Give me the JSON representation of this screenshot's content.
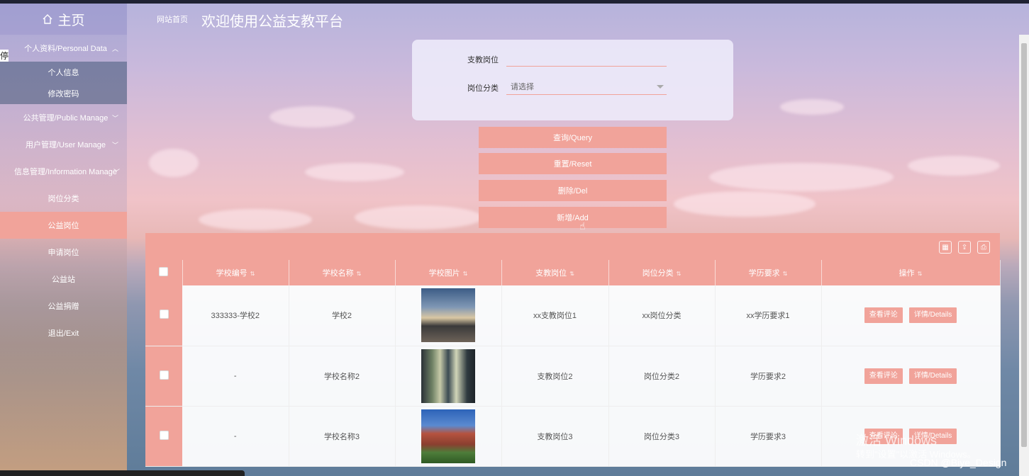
{
  "header": {
    "home_label": "主页",
    "breadcrumb": "网站首页",
    "title": "欢迎使用公益支教平台"
  },
  "sidebar": {
    "side_glyph": "停",
    "items": [
      {
        "label": "个人资料/Personal Data",
        "type": "group",
        "chevron": "︿"
      },
      {
        "label": "个人信息",
        "type": "sub"
      },
      {
        "label": "修改密码",
        "type": "sub"
      },
      {
        "label": "公共管理/Public Manage",
        "type": "group",
        "chevron": "﹀"
      },
      {
        "label": "用户管理/User Manage",
        "type": "group",
        "chevron": "﹀"
      },
      {
        "label": "信息管理/Information Manage",
        "type": "group",
        "chevron": "﹀"
      },
      {
        "label": "岗位分类",
        "type": "item"
      },
      {
        "label": "公益岗位",
        "type": "item",
        "active": true
      },
      {
        "label": "申请岗位",
        "type": "item"
      },
      {
        "label": "公益站",
        "type": "item"
      },
      {
        "label": "公益捐赠",
        "type": "item"
      },
      {
        "label": "退出/Exit",
        "type": "item"
      }
    ]
  },
  "search": {
    "position_label": "支教岗位",
    "position_value": "",
    "category_label": "岗位分类",
    "category_placeholder": "请选择"
  },
  "buttons": {
    "query": "查询/Query",
    "reset": "重置/Reset",
    "delete": "删除/Del",
    "add": "新增/Add"
  },
  "table": {
    "columns": [
      "学校编号",
      "学校名称",
      "学校图片",
      "支教岗位",
      "岗位分类",
      "学历要求",
      "操作"
    ],
    "rows": [
      {
        "school_no": "333333-学校2",
        "school_name": "学校2",
        "position": "xx支教岗位1",
        "category": "xx岗位分类",
        "education": "xx学历要求1"
      },
      {
        "school_no": "-",
        "school_name": "学校名称2",
        "position": "支教岗位2",
        "category": "岗位分类2",
        "education": "学历要求2"
      },
      {
        "school_no": "-",
        "school_name": "学校名称3",
        "position": "支教岗位3",
        "category": "岗位分类3",
        "education": "学历要求3"
      }
    ],
    "action_comments": "查看评论",
    "action_details": "详情/Details"
  },
  "overlay": {
    "watermark_line1": "激活 Windows",
    "watermark_line2": "转到\"设置\"以激活 Windows。",
    "csdn": "CSDN @Biye_Design"
  },
  "colors": {
    "accent": "#f1a39a",
    "sidebar_active": "#f1a39a",
    "header_text": "#ffffff"
  }
}
